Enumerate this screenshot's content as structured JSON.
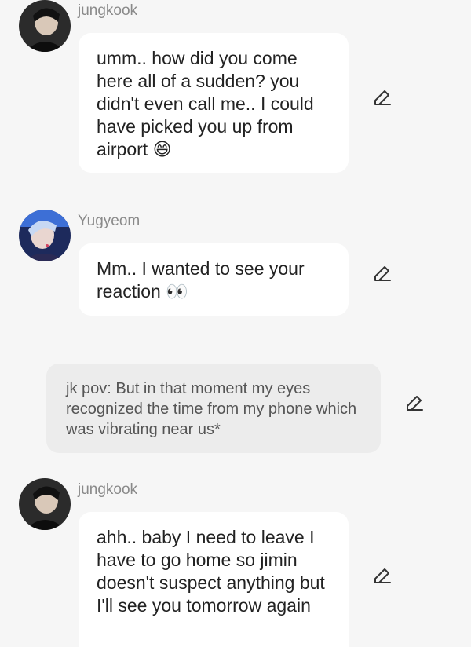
{
  "messages": [
    {
      "sender": "jungkook",
      "text": "umm.. how did you come here all of a sudden? you didn't even call me.. I could have picked you up from airport",
      "emoji": "😄",
      "avatar": "jungkook-avatar"
    },
    {
      "sender": "Yugyeom",
      "text": "Mm.. I wanted to see your reaction",
      "emoji": "👀",
      "avatar": "yugyeom-avatar"
    },
    {
      "narration": "jk pov: But in that moment my eyes recognized the time from  my phone which was vibrating near us*"
    },
    {
      "sender": "jungkook",
      "text": "ahh.. baby I need to leave I have to go home so jimin doesn't suspect anything but I'll see you tomorrow again",
      "avatar": "jungkook-avatar"
    }
  ],
  "icons": {
    "edit": "edit-pencil-icon"
  },
  "colors": {
    "background": "#f6f6f6",
    "bubble": "#ffffff",
    "narration_bubble": "#ececec",
    "sender_name": "#8a8a8a",
    "text": "#222222"
  }
}
